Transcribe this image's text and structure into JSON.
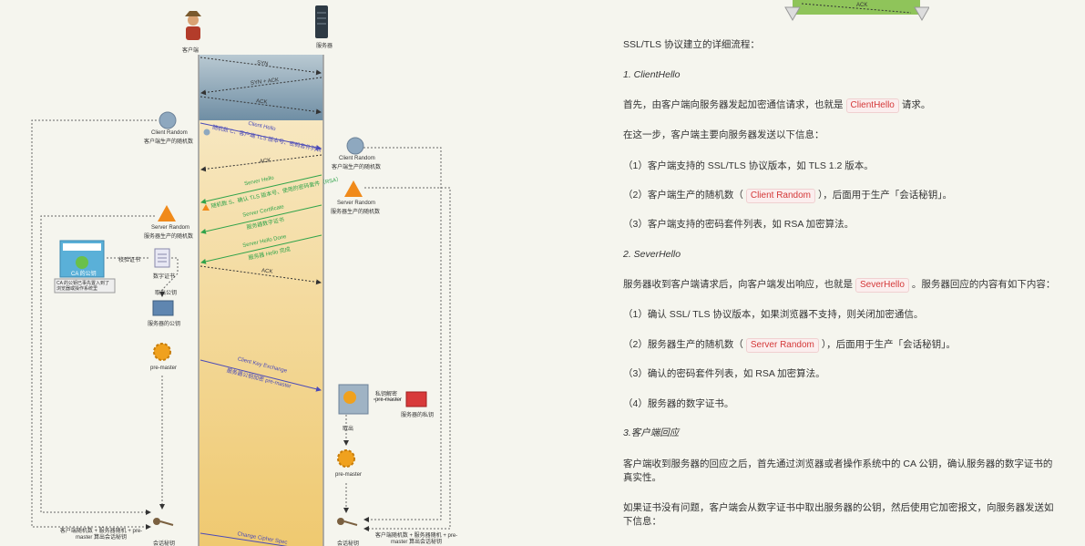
{
  "diagram": {
    "client_label": "客户端",
    "server_label": "服务器",
    "syn": "SYN",
    "syn_ack": "SYN + ACK",
    "ack1": "ACK",
    "client_hello": "Client Hello",
    "client_hello_desc": "随机数 C、客户端 TLS 版本号、密码套件列表",
    "ack2": "ACK",
    "server_hello": "Server Hello",
    "server_hello_desc": "随机数 S、确认 TLS 版本号、使用的密码套件（RSA）",
    "server_cert": "Server Certificate",
    "server_cert_desc": "服务器数字证书",
    "server_hello_done": "Server Hello Done",
    "server_hello_done_desc": "服务器 Hello 完成",
    "ack3": "ACK",
    "client_key_exchange": "Client Key Exchange",
    "client_key_exchange_desc": "服务器公钥加密 pre-master",
    "change_cipher": "Change Cipher Spec",
    "client_random_left": "Client Random",
    "client_random_left_desc": "客户端生产的随机数",
    "client_random_right": "Client Random",
    "client_random_right_desc": "客户端生产的随机数",
    "server_random_left": "Server Random",
    "server_random_left_desc": "服务器生产的随机数",
    "server_random_right": "Server Random",
    "server_random_right_desc": "服务器生产的随机数",
    "ca_label": "CA 的公钥",
    "ca_desc": "CA 的公钥已事先置入到了浏览器或操作系统里",
    "verify_cert": "校验证书",
    "digital_cert": "数字证书",
    "take_pubkey": "取出公钥",
    "server_pubkey": "服务器的公钥",
    "premaster_left": "pre-master",
    "private_decrypt": "私钥解密 pre-master",
    "server_private_key": "服务器的私钥",
    "take_out": "取出",
    "premaster_right": "pre-master",
    "session_left_formula": "客户端随机数 + 服务器随机 + pre-master 算出会话秘钥",
    "session_left": "会话秘钥",
    "session_right_formula": "客户端随机数 + 服务器随机 + pre-master 算出会话秘钥",
    "session_right": "会话秘钥",
    "top_ack": "ACK"
  },
  "article": {
    "intro": "SSL/TLS 协议建立的详细流程：",
    "h1": "1. ClientHello",
    "p1_pre": "首先，由客户端向服务器发起加密通信请求，也就是",
    "p1_tag": "ClientHello",
    "p1_post": "请求。",
    "p2": "在这一步，客户端主要向服务器发送以下信息：",
    "li1": "（1）客户端支持的 SSL/TLS 协议版本，如 TLS 1.2 版本。",
    "li2_pre": "（2）客户端生产的随机数（",
    "li2_tag": "Client Random",
    "li2_post": "），后面用于生产「会话秘钥」。",
    "li3": "（3）客户端支持的密码套件列表，如 RSA 加密算法。",
    "h2": "2. SeverHello",
    "p3_pre": "服务器收到客户端请求后，向客户端发出响应，也就是",
    "p3_tag": "SeverHello",
    "p3_post": "。服务器回应的内容有如下内容：",
    "li4": "（1）确认 SSL/ TLS 协议版本，如果浏览器不支持，则关闭加密通信。",
    "li5_pre": "（2）服务器生产的随机数（",
    "li5_tag": "Server Random",
    "li5_post": "），后面用于生产「会话秘钥」。",
    "li6": "（3）确认的密码套件列表，如 RSA 加密算法。",
    "li7": "（4）服务器的数字证书。",
    "h3": "3.客户端回应",
    "p4a": "客户端收到服务器的回应之后，首先通过浏览器或者操作系统中的 CA 公钥，确认服务器的数字证书的",
    "p4b": "真实性。",
    "p5a": "如果证书没有问题，客户端会从数字证书中取出服务器的公钥，然后使用它加密报文，向服务器发送如",
    "p5b": "下信息："
  },
  "colors": {
    "tcp_band": "#7f9bb0",
    "tls_band": "#f0d79a",
    "green_msg": "#2fa34a",
    "blue_msg": "#4a4ab8",
    "heading": "#6b2fc0",
    "tag_text": "#d43838"
  }
}
